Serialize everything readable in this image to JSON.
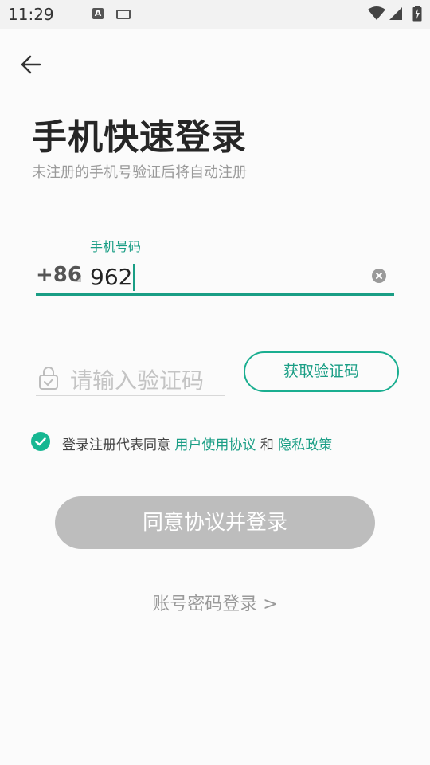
{
  "status_bar": {
    "time": "11:29",
    "a_icon": "A"
  },
  "header": {
    "title": "手机快速登录",
    "subtitle": "未注册的手机号验证后将自动注册"
  },
  "phone": {
    "label": "手机号码",
    "country_code": "+86",
    "value": "962"
  },
  "code": {
    "placeholder": "请输入验证码",
    "get_code_label": "获取验证码"
  },
  "agreement": {
    "prefix": "登录注册代表同意",
    "terms_link": "用户使用协议",
    "and": "和",
    "privacy_link": "隐私政策",
    "checked": true
  },
  "actions": {
    "login_label": "同意协议并登录",
    "password_login_label": "账号密码登录 >"
  },
  "colors": {
    "accent": "#1a9e85",
    "disabled_button": "#bdbdbd"
  },
  "icons": [
    "back-arrow-icon",
    "clear-icon",
    "lock-icon",
    "check-icon",
    "wifi-icon",
    "signal-icon",
    "battery-icon",
    "keyboard-icon"
  ]
}
